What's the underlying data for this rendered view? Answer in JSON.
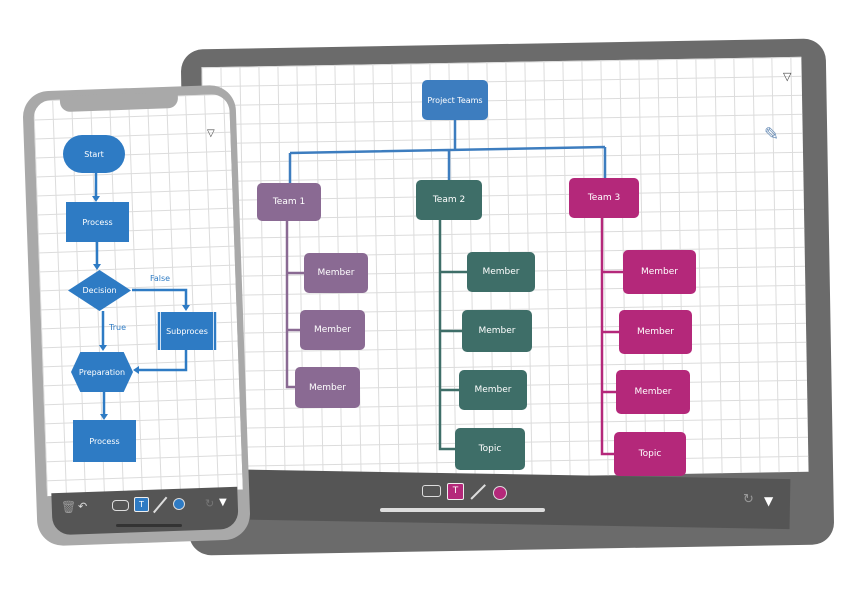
{
  "colors": {
    "blue": "#2e7bc4",
    "team1": "#8a6a93",
    "team2": "#3e6e68",
    "team3": "#b4287a",
    "root": "#3d7dbf"
  },
  "tablet": {
    "root": "Project Teams",
    "teams": [
      {
        "label": "Team 1",
        "children": [
          "Member",
          "Member",
          "Member"
        ]
      },
      {
        "label": "Team 2",
        "children": [
          "Member",
          "Member",
          "Member",
          "Topic"
        ]
      },
      {
        "label": "Team 3",
        "children": [
          "Member",
          "Member",
          "Member",
          "Topic"
        ]
      }
    ],
    "toolbar": [
      "rectangle-icon",
      "text-icon",
      "line-icon",
      "circle-icon",
      "redo-icon",
      "dropdown-icon"
    ],
    "text_tool": "T"
  },
  "phone": {
    "start": "Start",
    "process1": "Process",
    "decision": "Decision",
    "false_label": "False",
    "true_label": "True",
    "subprocess": "Subproces",
    "preparation": "Preparation",
    "process2": "Process",
    "toolbar": [
      "trash-icon",
      "undo-icon",
      "rectangle-icon",
      "text-icon",
      "arrow-icon",
      "circle-icon",
      "redo-icon",
      "dropdown-icon"
    ],
    "text_tool": "T"
  }
}
